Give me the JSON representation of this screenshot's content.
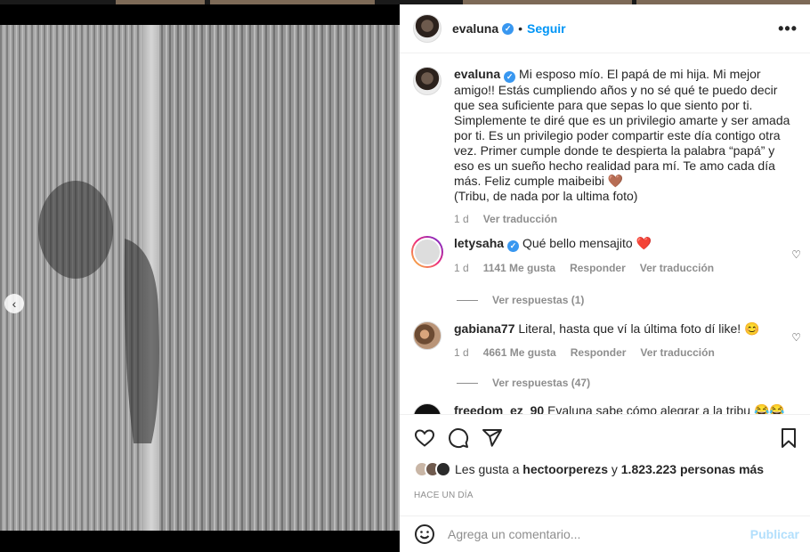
{
  "post": {
    "author": "evaluna",
    "follow_label": "Seguir",
    "more_label": "•••"
  },
  "caption": {
    "username": "evaluna",
    "text": "Mi esposo mío. El papá de mi hija. Mi mejor amigo!! Estás cumpliendo años y no sé qué te puedo decir que sea suficiente para que sepas lo que siento por ti. Simplemente te diré que es un privilegio amarte y ser amada por ti. Es un privilegio poder compartir este día contigo otra vez. Primer cumple donde te despierta la palabra “papá” y eso es un sueño hecho realidad para mí. Te amo cada día más. Feliz cumple maibeibi 🤎",
    "text2": "(Tribu, de nada por la ultima foto)",
    "time": "1 d",
    "translate": "Ver traducción"
  },
  "comments": [
    {
      "username": "letysaha",
      "text": "Qué bello mensajito ❤️",
      "time": "1 d",
      "likes": "1141 Me gusta",
      "reply": "Responder",
      "translate": "Ver traducción",
      "replies": "Ver respuestas (1)"
    },
    {
      "username": "gabiana77",
      "text": "Literal, hasta que ví la última foto dí like! 😊",
      "time": "1 d",
      "likes": "4661 Me gusta",
      "reply": "Responder",
      "translate": "Ver traducción",
      "replies": "Ver respuestas (47)"
    },
    {
      "username": "freedom_ez_90",
      "text": "Evaluna sabe cómo alegrar a la tribu 😂😂😂"
    }
  ],
  "likes": {
    "prefix": "Les gusta a",
    "user": "hectoorperezs",
    "connector": "y",
    "others": "1.823.223 personas más"
  },
  "time_ago": "HACE UN DÍA",
  "comment_box": {
    "placeholder": "Agrega un comentario...",
    "publish_label": "Publicar"
  },
  "carousel": {
    "count": 10,
    "active_index": 9
  },
  "colors": {
    "accent": "#0095f6",
    "muted": "#8e8e8e",
    "heart": "#ed4956"
  }
}
